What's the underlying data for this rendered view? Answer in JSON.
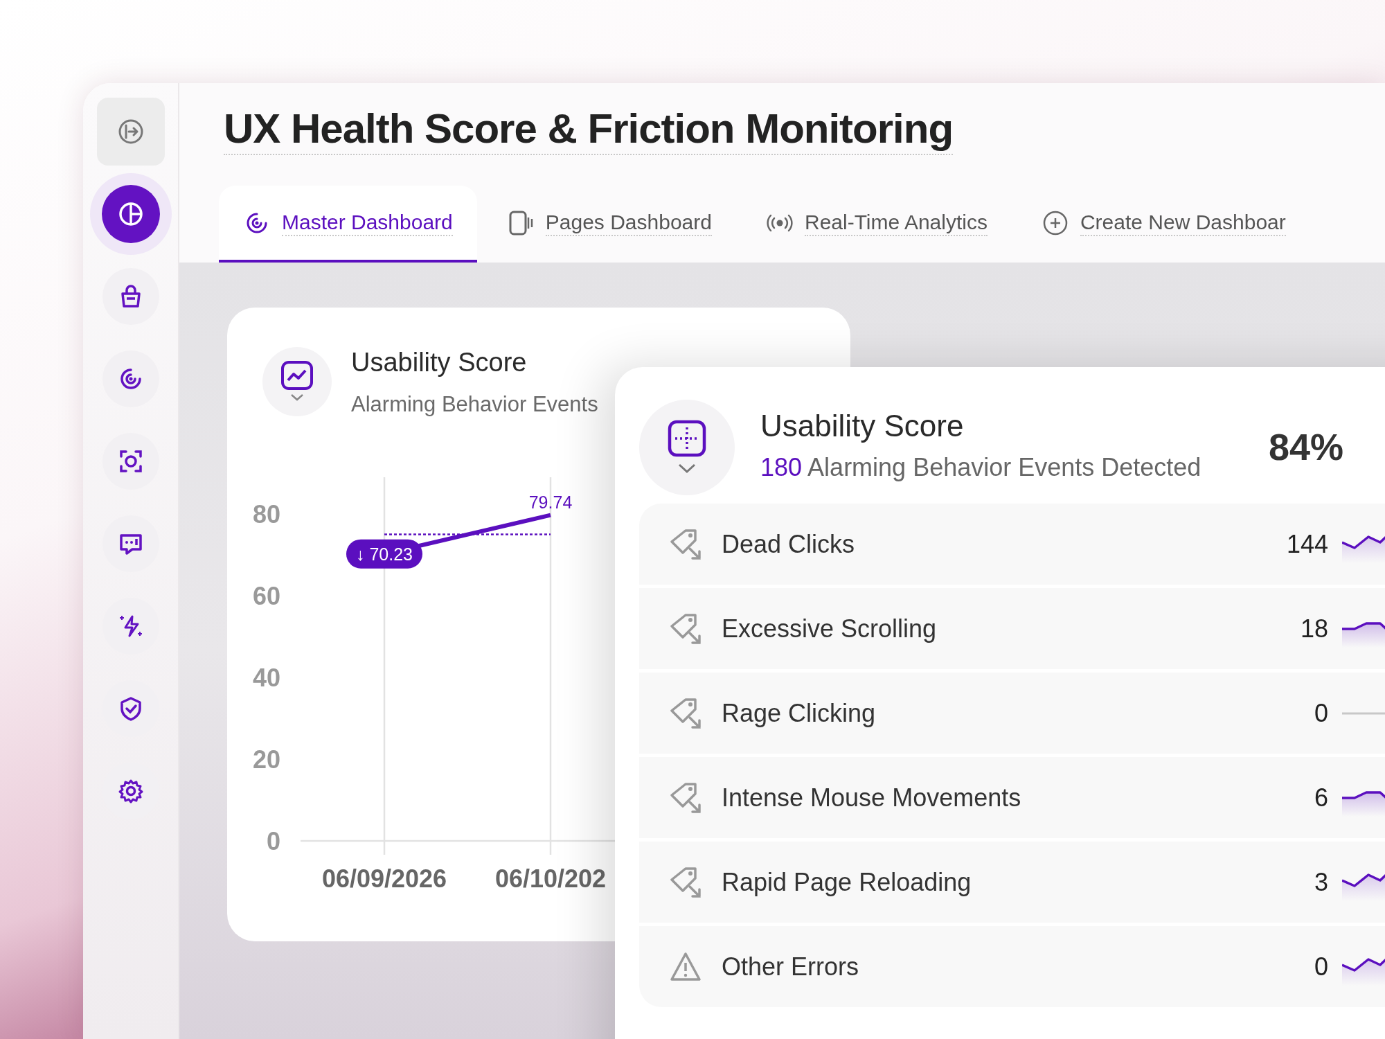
{
  "title": "UX Health Score & Friction Monitoring",
  "sidebar": {
    "items": [
      {
        "selected": true
      },
      {
        "selected": false
      },
      {
        "selected": false
      },
      {
        "selected": false
      },
      {
        "selected": false
      },
      {
        "selected": false
      },
      {
        "selected": false
      },
      {
        "selected": false
      }
    ]
  },
  "tabs": [
    {
      "label": "Master Dashboard",
      "selected": true
    },
    {
      "label": "Pages Dashboard",
      "selected": false
    },
    {
      "label": "Real-Time Analytics",
      "selected": false
    },
    {
      "label": "Create New Dashboar",
      "selected": false
    }
  ],
  "chart_card": {
    "title": "Usability Score",
    "subtitle": "Alarming Behavior Events",
    "chart_data": {
      "type": "line",
      "categories": [
        "06/09/2026",
        "06/10/202"
      ],
      "series": [
        {
          "color": "#5b0fbf",
          "values": [
            70.23,
            79.74
          ]
        },
        {
          "color": "#5b0fbf",
          "line_style": "dashed",
          "values": [
            75,
            75
          ]
        }
      ],
      "ylim": [
        0,
        89
      ],
      "yticks": [
        0,
        20,
        40,
        60,
        80
      ],
      "value_labels": [
        "↓ 70.23",
        "79.74"
      ]
    }
  },
  "score_panel": {
    "title": "Usability Score",
    "event_count": "180",
    "summary": "Alarming Behavior Events Detected",
    "score": "84%",
    "rows": [
      {
        "kind": "tag",
        "label": "Dead Clicks",
        "count": "144",
        "sparkline": {
          "kind": "zigzag"
        }
      },
      {
        "kind": "tag",
        "label": "Excessive Scrolling",
        "count": "18",
        "sparkline": {
          "kind": "plateau"
        }
      },
      {
        "kind": "tag",
        "label": "Rage Clicking",
        "count": "0",
        "sparkline": {
          "kind": "flat"
        }
      },
      {
        "kind": "tag",
        "label": "Intense Mouse Movements",
        "count": "6",
        "sparkline": {
          "kind": "plateau"
        }
      },
      {
        "kind": "tag",
        "label": "Rapid Page Reloading",
        "count": "3",
        "sparkline": {
          "kind": "zigzag"
        }
      },
      {
        "kind": "warning",
        "label": "Other Errors",
        "count": "0",
        "sparkline": {
          "kind": "zigzag"
        }
      }
    ]
  }
}
